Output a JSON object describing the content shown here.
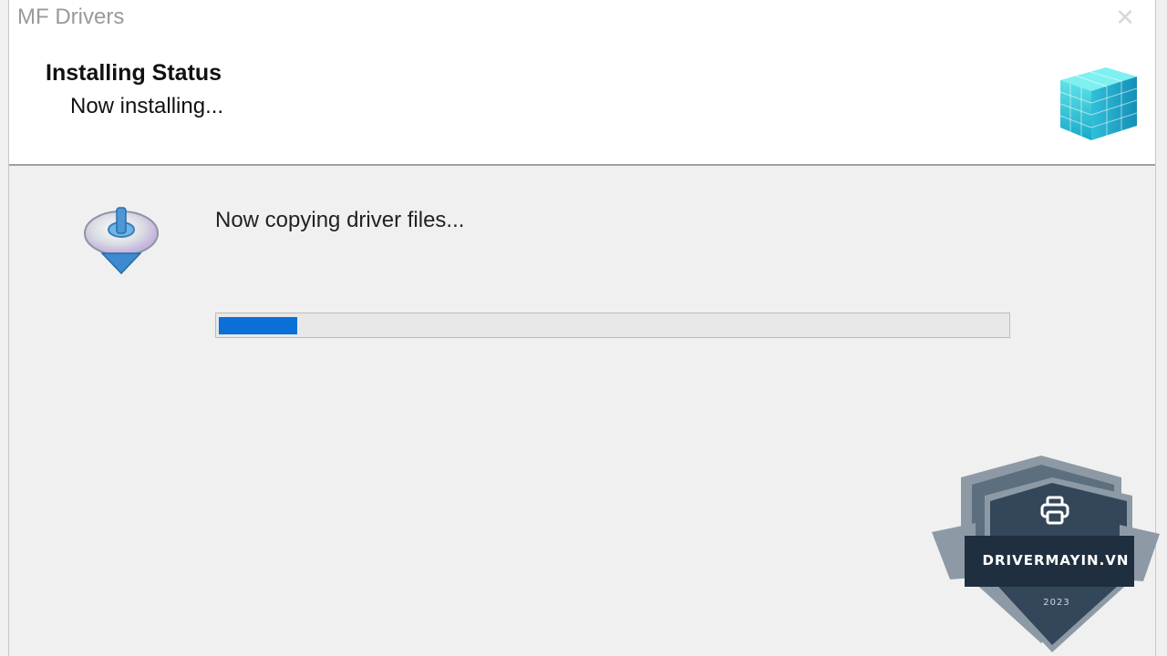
{
  "window": {
    "title": "MF Drivers",
    "close_glyph": "✕"
  },
  "header": {
    "title": "Installing Status",
    "subtitle": "Now installing...",
    "icon": "package-cube-icon"
  },
  "content": {
    "icon": "disc-download-icon",
    "status_text": "Now copying driver files...",
    "progress_fraction": 0.1
  },
  "watermark": {
    "brand": "DRIVERMAYIN.VN",
    "year": "2023",
    "icon": "printer-icon"
  },
  "colors": {
    "progress_fill": "#0a6fd6",
    "shield_dark": "#34475a",
    "shield_light": "#8d9aa6"
  }
}
